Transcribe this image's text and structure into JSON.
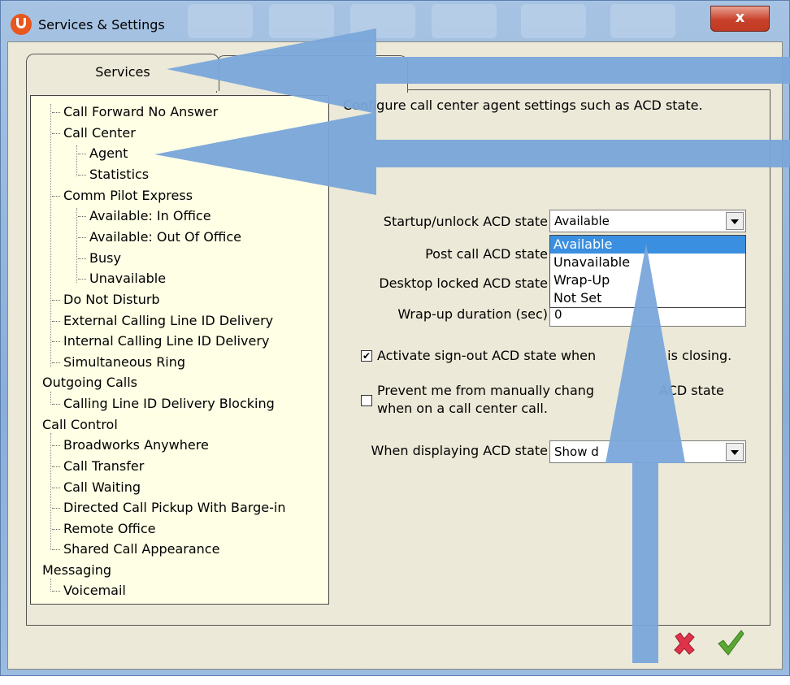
{
  "window": {
    "title": "Services & Settings",
    "close_label": "x"
  },
  "tabs": [
    {
      "label": "Services"
    },
    {
      "label": ""
    }
  ],
  "tree": {
    "items": [
      {
        "label": "Call Forward No Answer"
      },
      {
        "label": "Call Center"
      },
      {
        "label": "Agent"
      },
      {
        "label": "Statistics"
      },
      {
        "label": "Comm Pilot Express"
      },
      {
        "label": "Available: In Office"
      },
      {
        "label": "Available: Out Of Office"
      },
      {
        "label": "Busy"
      },
      {
        "label": "Unavailable"
      },
      {
        "label": "Do Not Disturb"
      },
      {
        "label": "External Calling Line ID Delivery"
      },
      {
        "label": "Internal Calling Line ID Delivery"
      },
      {
        "label": "Simultaneous Ring"
      },
      {
        "label": "Outgoing Calls"
      },
      {
        "label": "Calling Line ID Delivery Blocking"
      },
      {
        "label": "Call Control"
      },
      {
        "label": "Broadworks Anywhere"
      },
      {
        "label": "Call Transfer"
      },
      {
        "label": "Call Waiting"
      },
      {
        "label": "Directed Call Pickup With Barge-in"
      },
      {
        "label": "Remote Office"
      },
      {
        "label": "Shared Call Appearance"
      },
      {
        "label": "Messaging"
      },
      {
        "label": "Voicemail"
      }
    ]
  },
  "settings": {
    "description": "Configure call center agent settings such as ACD state.",
    "description_visible": "Con igure call center agent settings such as ACD state.",
    "startup_label": "Startup/unlock ACD state",
    "startup_value": "Available",
    "post_call_label": "Post call ACD state",
    "desktop_locked_label": "Desktop locked ACD state",
    "wrapup_label": "Wrap-up duration (sec)",
    "wrapup_value": "0",
    "dropdown_options": [
      "Available",
      "Unavailable",
      "Wrap-Up",
      "Not Set"
    ],
    "checkbox1_label": "Activate sign-out ACD state when",
    "checkbox1_label_tail": "is closing.",
    "checkbox1_checked": true,
    "checkbox2_line1": "Prevent me from manually chang",
    "checkbox2_line1_tail": "ACD state",
    "checkbox2_line2": "when on a call center call.",
    "checkbox2_checked": false,
    "display_label": "When displaying ACD state",
    "display_value": "Show d"
  },
  "colors": {
    "annotation_arrow": "#7aa6da",
    "dropdown_highlight": "#3a8fe0",
    "cancel": "#e0334a",
    "ok": "#5aa833"
  },
  "icons": {
    "cancel": "red-x-icon",
    "ok": "green-check-icon"
  }
}
